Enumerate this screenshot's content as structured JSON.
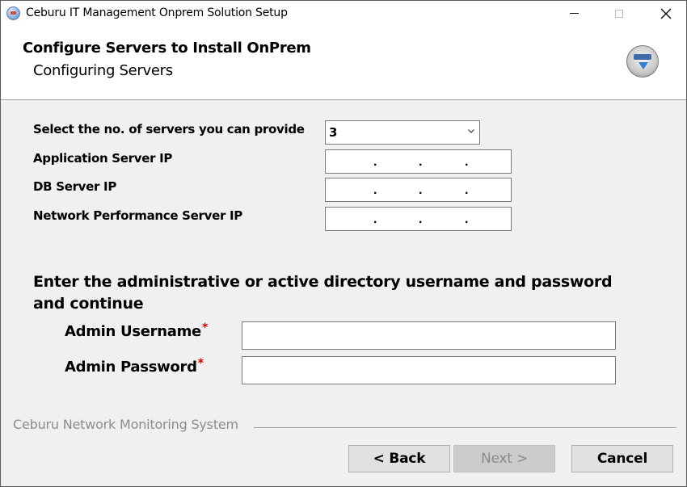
{
  "window": {
    "title": "Ceburu IT Management Onprem Solution Setup"
  },
  "header": {
    "title": "Configure Servers to Install OnPrem",
    "subtitle": "Configuring Servers"
  },
  "form": {
    "servers_label": "Select the no. of servers you can provide",
    "servers_value": "3",
    "app_server_label": "Application Server IP",
    "db_server_label": "DB Server IP",
    "net_perf_server_label": "Network Performance Server IP",
    "ip_dot": ".",
    "prompt": "Enter the administrative or active directory username and password and continue",
    "admin_username_label": "Admin Username",
    "admin_password_label": "Admin Password",
    "required_mark": "*",
    "admin_username_value": "",
    "admin_password_value": ""
  },
  "footer": {
    "brand": "Ceburu Network Monitoring System",
    "back_label": "< Back",
    "next_label": "Next >",
    "cancel_label": "Cancel"
  },
  "colors": {
    "required": "#e00000",
    "disabled_text": "#8a8a8a"
  },
  "icons": [
    "app-icon",
    "minimize-icon",
    "maximize-icon",
    "close-icon",
    "setup-logo-icon",
    "chevron-down-icon"
  ]
}
